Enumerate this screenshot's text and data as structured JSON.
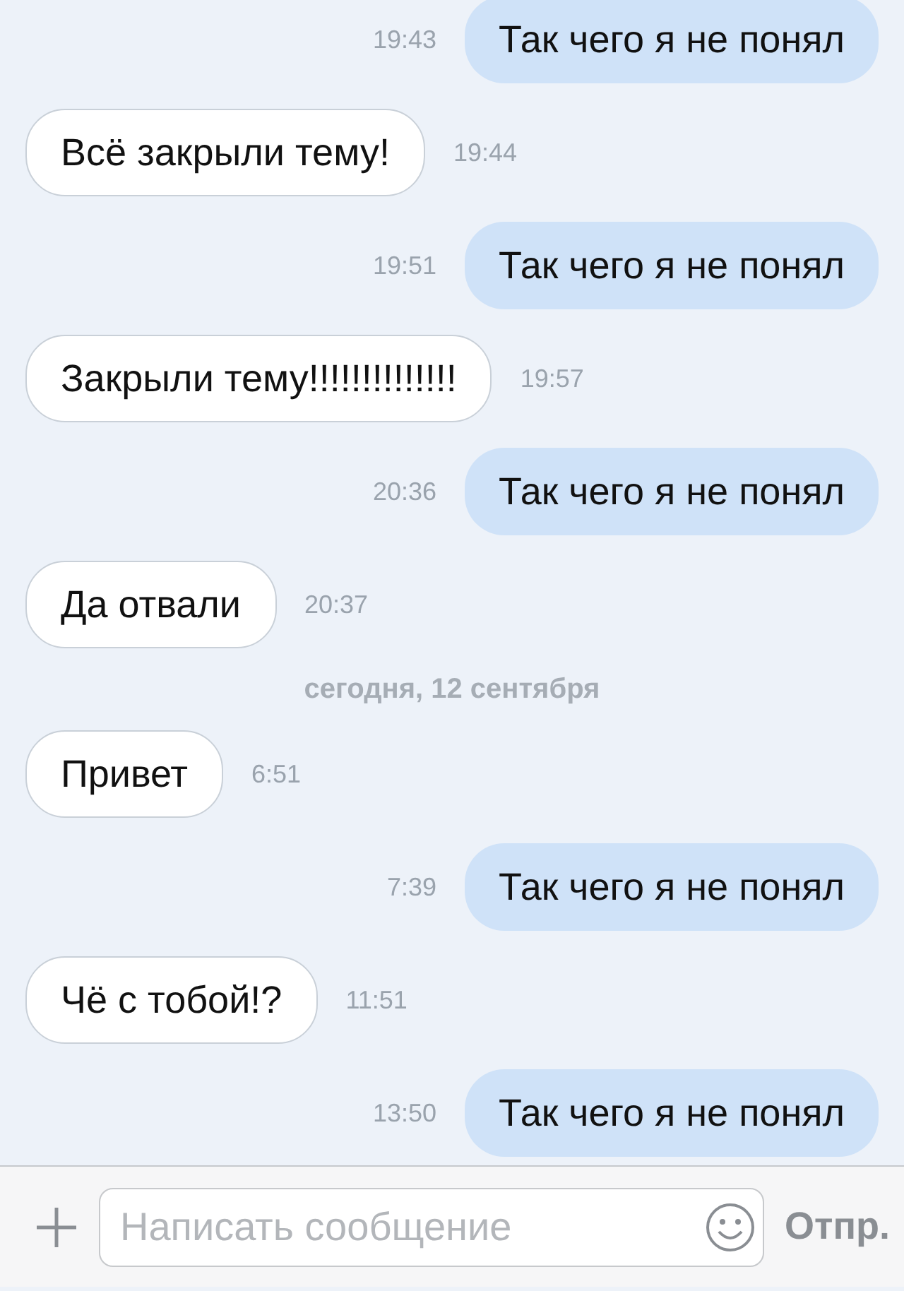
{
  "messages": [
    {
      "kind": "outgoing",
      "text": "Так чего я не понял",
      "time": "19:43"
    },
    {
      "kind": "incoming",
      "text": "Всё закрыли тему!",
      "time": "19:44"
    },
    {
      "kind": "outgoing",
      "text": "Так чего я не понял",
      "time": "19:51"
    },
    {
      "kind": "incoming",
      "text": "Закрыли тему!!!!!!!!!!!!!!",
      "time": "19:57"
    },
    {
      "kind": "outgoing",
      "text": "Так чего я не понял",
      "time": "20:36"
    },
    {
      "kind": "incoming",
      "text": "Да отвали",
      "time": "20:37"
    },
    {
      "kind": "date",
      "text": "сегодня, 12 сентября"
    },
    {
      "kind": "incoming",
      "text": "Привет",
      "time": "6:51"
    },
    {
      "kind": "outgoing",
      "text": "Так чего я не понял",
      "time": "7:39"
    },
    {
      "kind": "incoming",
      "text": "Чё с тобой!?",
      "time": "11:51"
    },
    {
      "kind": "outgoing",
      "text": "Так чего я не понял",
      "time": "13:50"
    }
  ],
  "composer": {
    "placeholder": "Написать сообщение",
    "send": "Отпр."
  }
}
